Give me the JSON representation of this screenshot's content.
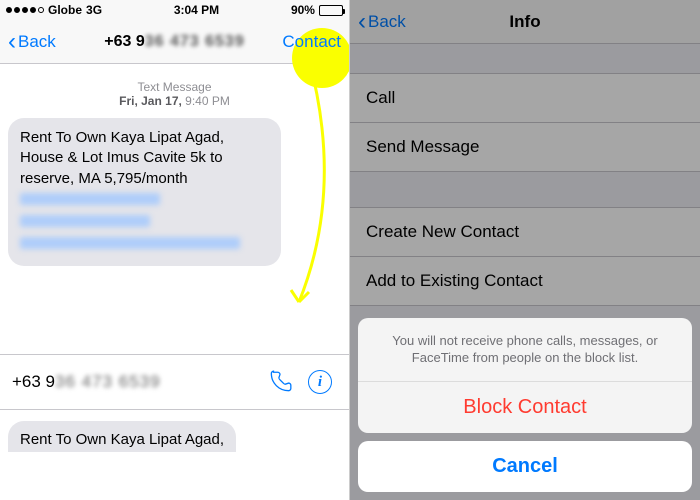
{
  "status": {
    "carrier": "Globe",
    "network": "3G",
    "time": "3:04 PM",
    "battery_pct": "90%"
  },
  "left": {
    "back_label": "Back",
    "title_prefix": "+63 9",
    "title_blur": "36 473 6539",
    "contact_label": "Contact",
    "msg_label": "Text Message",
    "msg_date": "Fri, Jan 17,",
    "msg_time": "9:40 PM",
    "bubble_text": "Rent To Own Kaya Lipat Agad, House & Lot Imus Cavite 5k to reserve, MA 5,795/month",
    "bottom_number_prefix": "+63 9",
    "bottom_number_blur": "36 473 6539",
    "preview_text": "Rent To Own Kaya Lipat Agad,"
  },
  "right": {
    "back_label": "Back",
    "title": "Info",
    "rows": {
      "call": "Call",
      "send_message": "Send Message",
      "create_contact": "Create New Contact",
      "add_existing": "Add to Existing Contact"
    },
    "sheet_message": "You will not receive phone calls, messages, or FaceTime from people on the block list.",
    "block_label": "Block Contact",
    "cancel_label": "Cancel"
  }
}
